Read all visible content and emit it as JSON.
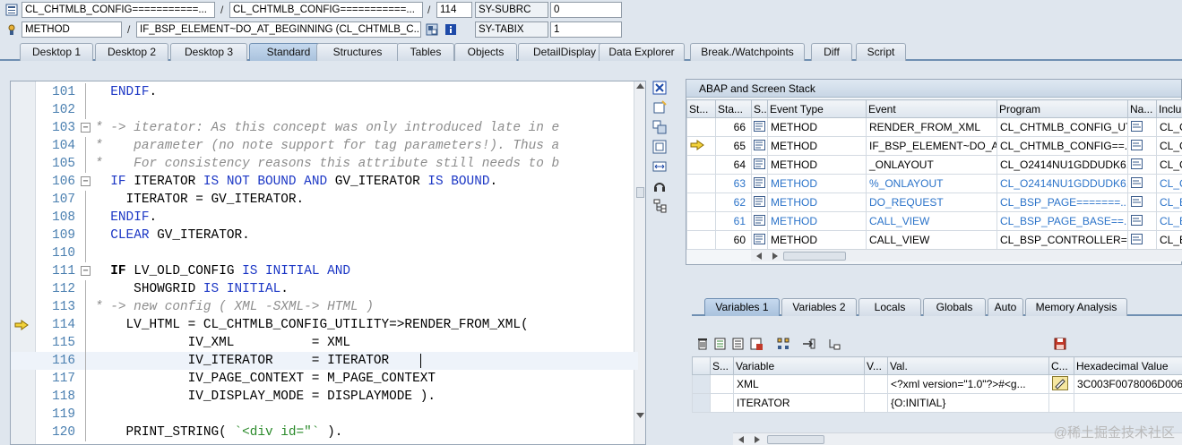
{
  "header": {
    "row1": {
      "class_field": "CL_CHTMLB_CONFIG===========...",
      "class_field2": "CL_CHTMLB_CONFIG===========...",
      "line_no": "114",
      "sysvar_label": "SY-SUBRC",
      "sysvar_value": "0"
    },
    "row2": {
      "type_field": "METHOD",
      "method_field": "IF_BSP_ELEMENT~DO_AT_BEGINNING (CL_CHTMLB_C...",
      "sysvar_label": "SY-TABIX",
      "sysvar_value": "1"
    },
    "slash": "/"
  },
  "tabs": [
    "Desktop 1",
    "Desktop 2",
    "Desktop 3",
    "Standard",
    "Structures",
    "Tables",
    "Objects",
    "DetailDisplay",
    "Data Explorer",
    "Break./Watchpoints",
    "Diff",
    "Script"
  ],
  "active_tab": "Standard",
  "editor": {
    "lines": [
      {
        "n": "101",
        "fold": "",
        "code": [
          [
            "",
            "  "
          ],
          [
            "kw",
            "ENDIF"
          ],
          [
            "",
            "."
          ]
        ]
      },
      {
        "n": "102",
        "fold": "",
        "code": []
      },
      {
        "n": "103",
        "fold": "⊟",
        "code": [
          [
            "cm",
            "* -> iterator: As this concept was only introduced late in e"
          ]
        ]
      },
      {
        "n": "104",
        "fold": "",
        "code": [
          [
            "cm",
            "*    parameter (no note support for tag parameters!). Thus a"
          ]
        ]
      },
      {
        "n": "105",
        "fold": "",
        "code": [
          [
            "cm",
            "*    For consistency reasons this attribute still needs to b"
          ]
        ]
      },
      {
        "n": "106",
        "fold": "⊟",
        "code": [
          [
            "",
            "  "
          ],
          [
            "kw",
            "IF"
          ],
          [
            "",
            " ITERATOR "
          ],
          [
            "kw",
            "IS NOT BOUND AND"
          ],
          [
            "",
            " GV_ITERATOR "
          ],
          [
            "kw",
            "IS BOUND"
          ],
          [
            "",
            "."
          ]
        ]
      },
      {
        "n": "107",
        "fold": "",
        "code": [
          [
            "",
            "    ITERATOR = GV_ITERATOR."
          ]
        ]
      },
      {
        "n": "108",
        "fold": "",
        "code": [
          [
            "",
            "  "
          ],
          [
            "kw",
            "ENDIF"
          ],
          [
            "",
            "."
          ]
        ]
      },
      {
        "n": "109",
        "fold": "",
        "code": [
          [
            "",
            "  "
          ],
          [
            "kw",
            "CLEAR"
          ],
          [
            "",
            " GV_ITERATOR."
          ]
        ]
      },
      {
        "n": "110",
        "fold": "",
        "code": []
      },
      {
        "n": "111",
        "fold": "⊟",
        "code": [
          [
            "",
            "  "
          ],
          [
            "kwb",
            "IF"
          ],
          [
            "",
            " LV_OLD_CONFIG "
          ],
          [
            "kw",
            "IS INITIAL AND"
          ]
        ]
      },
      {
        "n": "112",
        "fold": "",
        "code": [
          [
            "",
            "     SHOWGRID "
          ],
          [
            "kw",
            "IS INITIAL"
          ],
          [
            "",
            "."
          ]
        ]
      },
      {
        "n": "113",
        "fold": "",
        "code": [
          [
            "cm",
            "* -> new config ( XML -SXML-> HTML )"
          ]
        ]
      },
      {
        "n": "114",
        "fold": "",
        "bp": true,
        "code": [
          [
            "",
            "    LV_HTML = CL_CHTMLB_CONFIG_UTILITY=>RENDER_FROM_XML("
          ]
        ]
      },
      {
        "n": "115",
        "fold": "",
        "code": [
          [
            "",
            "            IV_XML          = XML"
          ]
        ]
      },
      {
        "n": "116",
        "fold": "",
        "cur": true,
        "code": [
          [
            "",
            "            IV_ITERATOR     = ITERATOR"
          ]
        ]
      },
      {
        "n": "117",
        "fold": "",
        "code": [
          [
            "",
            "            IV_PAGE_CONTEXT = M_PAGE_CONTEXT"
          ]
        ]
      },
      {
        "n": "118",
        "fold": "",
        "code": [
          [
            "",
            "            IV_DISPLAY_MODE = DISPLAYMODE )."
          ]
        ]
      },
      {
        "n": "119",
        "fold": "",
        "code": []
      },
      {
        "n": "120",
        "fold": "",
        "code": [
          [
            "",
            "    PRINT_STRING( "
          ],
          [
            "st",
            "`<div id=\"`"
          ],
          [
            "",
            " )."
          ]
        ]
      }
    ]
  },
  "stack": {
    "title": "ABAP and Screen Stack",
    "columns": [
      "St...",
      "Sta...",
      "S...",
      "Event Type",
      "Event",
      "Program",
      "Na...",
      "Inclu"
    ],
    "rows": [
      {
        "level": "66",
        "type": "METHOD",
        "event": "RENDER_FROM_XML",
        "program": "CL_CHTMLB_CONFIG_UT...",
        "incl": "CL_C",
        "blue": false,
        "current": false
      },
      {
        "level": "65",
        "type": "METHOD",
        "event": "IF_BSP_ELEMENT~DO_A...",
        "program": "CL_CHTMLB_CONFIG==...",
        "incl": "CL_C",
        "blue": false,
        "current": true
      },
      {
        "level": "64",
        "type": "METHOD",
        "event": "_ONLAYOUT",
        "program": "CL_O2414NU1GDDUDK6...",
        "incl": "CL_C",
        "blue": false,
        "current": false
      },
      {
        "level": "63",
        "type": "METHOD",
        "event": "%_ONLAYOUT",
        "program": "CL_O2414NU1GDDUDK6...",
        "incl": "CL_C",
        "blue": true,
        "current": false
      },
      {
        "level": "62",
        "type": "METHOD",
        "event": "DO_REQUEST",
        "program": "CL_BSP_PAGE=======...",
        "incl": "CL_B",
        "blue": true,
        "current": false
      },
      {
        "level": "61",
        "type": "METHOD",
        "event": "CALL_VIEW",
        "program": "CL_BSP_PAGE_BASE==...",
        "incl": "CL_B",
        "blue": true,
        "current": false
      },
      {
        "level": "60",
        "type": "METHOD",
        "event": "CALL_VIEW",
        "program": "CL_BSP_CONTROLLER=...",
        "incl": "CL_B",
        "blue": false,
        "current": false
      }
    ]
  },
  "var_tabs": [
    "Variables 1",
    "Variables 2",
    "Locals",
    "Globals",
    "Auto",
    "Memory Analysis"
  ],
  "active_var_tab": "Variables 1",
  "vars": {
    "columns": [
      "S...",
      "Variable",
      "V...",
      "Val.",
      "C...",
      "Hexadecimal Value"
    ],
    "rows": [
      {
        "name": "XML",
        "value": "<?xml version=\"1.0\"?>#<g...",
        "hex": "3C003F0078006D006C"
      },
      {
        "name": "ITERATOR",
        "value": "{O:INITIAL}",
        "hex": ""
      }
    ]
  },
  "watermark": "@稀土掘金技术社区"
}
